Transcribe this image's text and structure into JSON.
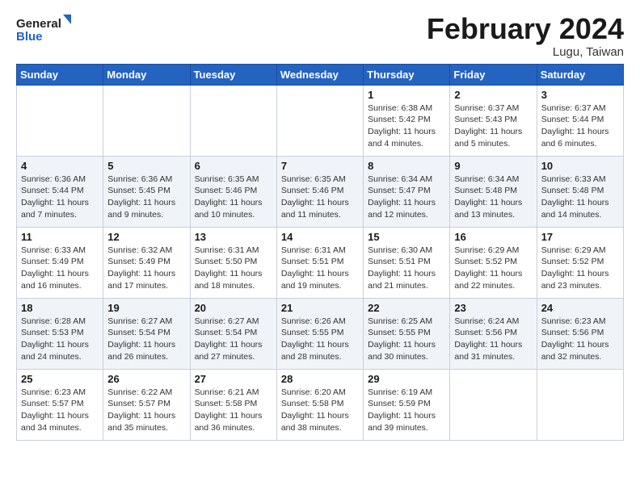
{
  "logo": {
    "line1": "General",
    "line2": "Blue"
  },
  "title": "February 2024",
  "subtitle": "Lugu, Taiwan",
  "days_of_week": [
    "Sunday",
    "Monday",
    "Tuesday",
    "Wednesday",
    "Thursday",
    "Friday",
    "Saturday"
  ],
  "weeks": [
    [
      {
        "day": "",
        "info": ""
      },
      {
        "day": "",
        "info": ""
      },
      {
        "day": "",
        "info": ""
      },
      {
        "day": "",
        "info": ""
      },
      {
        "day": "1",
        "info": "Sunrise: 6:38 AM\nSunset: 5:42 PM\nDaylight: 11 hours and 4 minutes."
      },
      {
        "day": "2",
        "info": "Sunrise: 6:37 AM\nSunset: 5:43 PM\nDaylight: 11 hours and 5 minutes."
      },
      {
        "day": "3",
        "info": "Sunrise: 6:37 AM\nSunset: 5:44 PM\nDaylight: 11 hours and 6 minutes."
      }
    ],
    [
      {
        "day": "4",
        "info": "Sunrise: 6:36 AM\nSunset: 5:44 PM\nDaylight: 11 hours and 7 minutes."
      },
      {
        "day": "5",
        "info": "Sunrise: 6:36 AM\nSunset: 5:45 PM\nDaylight: 11 hours and 9 minutes."
      },
      {
        "day": "6",
        "info": "Sunrise: 6:35 AM\nSunset: 5:46 PM\nDaylight: 11 hours and 10 minutes."
      },
      {
        "day": "7",
        "info": "Sunrise: 6:35 AM\nSunset: 5:46 PM\nDaylight: 11 hours and 11 minutes."
      },
      {
        "day": "8",
        "info": "Sunrise: 6:34 AM\nSunset: 5:47 PM\nDaylight: 11 hours and 12 minutes."
      },
      {
        "day": "9",
        "info": "Sunrise: 6:34 AM\nSunset: 5:48 PM\nDaylight: 11 hours and 13 minutes."
      },
      {
        "day": "10",
        "info": "Sunrise: 6:33 AM\nSunset: 5:48 PM\nDaylight: 11 hours and 14 minutes."
      }
    ],
    [
      {
        "day": "11",
        "info": "Sunrise: 6:33 AM\nSunset: 5:49 PM\nDaylight: 11 hours and 16 minutes."
      },
      {
        "day": "12",
        "info": "Sunrise: 6:32 AM\nSunset: 5:49 PM\nDaylight: 11 hours and 17 minutes."
      },
      {
        "day": "13",
        "info": "Sunrise: 6:31 AM\nSunset: 5:50 PM\nDaylight: 11 hours and 18 minutes."
      },
      {
        "day": "14",
        "info": "Sunrise: 6:31 AM\nSunset: 5:51 PM\nDaylight: 11 hours and 19 minutes."
      },
      {
        "day": "15",
        "info": "Sunrise: 6:30 AM\nSunset: 5:51 PM\nDaylight: 11 hours and 21 minutes."
      },
      {
        "day": "16",
        "info": "Sunrise: 6:29 AM\nSunset: 5:52 PM\nDaylight: 11 hours and 22 minutes."
      },
      {
        "day": "17",
        "info": "Sunrise: 6:29 AM\nSunset: 5:52 PM\nDaylight: 11 hours and 23 minutes."
      }
    ],
    [
      {
        "day": "18",
        "info": "Sunrise: 6:28 AM\nSunset: 5:53 PM\nDaylight: 11 hours and 24 minutes."
      },
      {
        "day": "19",
        "info": "Sunrise: 6:27 AM\nSunset: 5:54 PM\nDaylight: 11 hours and 26 minutes."
      },
      {
        "day": "20",
        "info": "Sunrise: 6:27 AM\nSunset: 5:54 PM\nDaylight: 11 hours and 27 minutes."
      },
      {
        "day": "21",
        "info": "Sunrise: 6:26 AM\nSunset: 5:55 PM\nDaylight: 11 hours and 28 minutes."
      },
      {
        "day": "22",
        "info": "Sunrise: 6:25 AM\nSunset: 5:55 PM\nDaylight: 11 hours and 30 minutes."
      },
      {
        "day": "23",
        "info": "Sunrise: 6:24 AM\nSunset: 5:56 PM\nDaylight: 11 hours and 31 minutes."
      },
      {
        "day": "24",
        "info": "Sunrise: 6:23 AM\nSunset: 5:56 PM\nDaylight: 11 hours and 32 minutes."
      }
    ],
    [
      {
        "day": "25",
        "info": "Sunrise: 6:23 AM\nSunset: 5:57 PM\nDaylight: 11 hours and 34 minutes."
      },
      {
        "day": "26",
        "info": "Sunrise: 6:22 AM\nSunset: 5:57 PM\nDaylight: 11 hours and 35 minutes."
      },
      {
        "day": "27",
        "info": "Sunrise: 6:21 AM\nSunset: 5:58 PM\nDaylight: 11 hours and 36 minutes."
      },
      {
        "day": "28",
        "info": "Sunrise: 6:20 AM\nSunset: 5:58 PM\nDaylight: 11 hours and 38 minutes."
      },
      {
        "day": "29",
        "info": "Sunrise: 6:19 AM\nSunset: 5:59 PM\nDaylight: 11 hours and 39 minutes."
      },
      {
        "day": "",
        "info": ""
      },
      {
        "day": "",
        "info": ""
      }
    ]
  ]
}
